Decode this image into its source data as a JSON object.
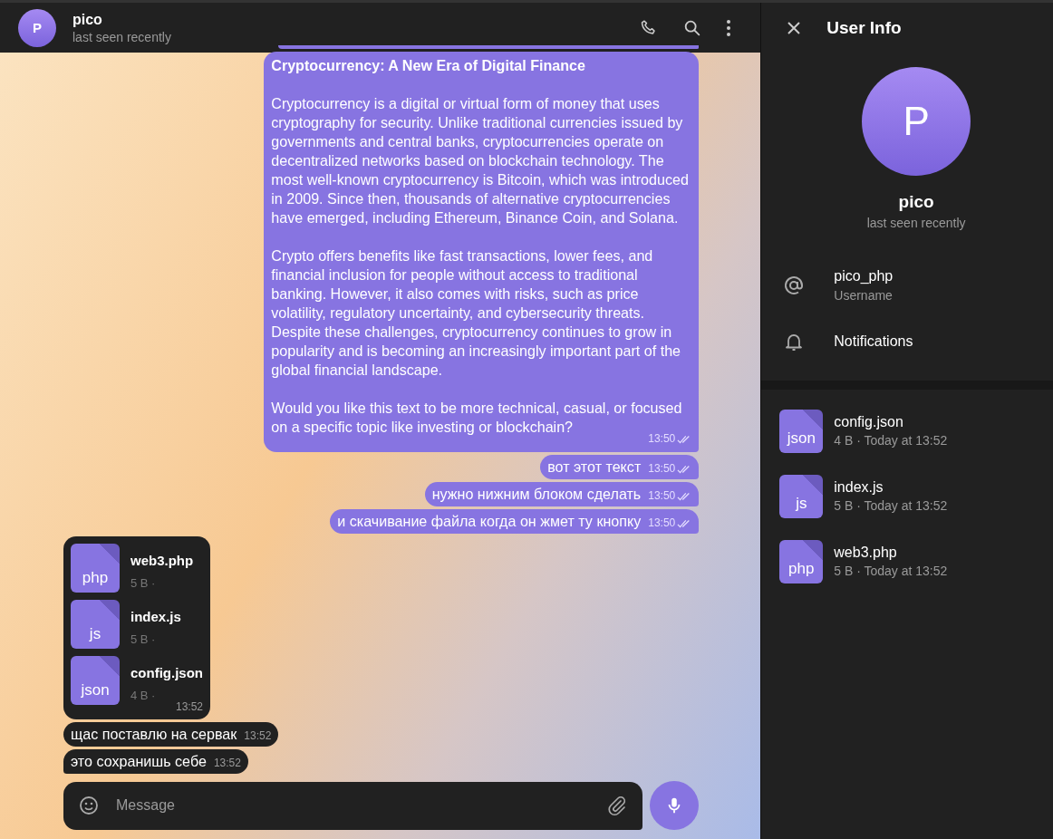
{
  "chat_header": {
    "avatar_letter": "P",
    "name": "pico",
    "status": "last seen recently"
  },
  "messages": [
    {
      "kind": "stub",
      "outgoing": true
    },
    {
      "kind": "text",
      "outgoing": true,
      "title": "Cryptocurrency: A New Era of Digital Finance",
      "paragraphs": [
        "Cryptocurrency is a digital or virtual form of money that uses cryptography for security. Unlike traditional currencies issued by governments and central banks, cryptocurrencies operate on decentralized networks based on blockchain technology. The most well-known cryptocurrency is Bitcoin, which was introduced in 2009. Since then, thousands of alternative cryptocurrencies have emerged, including Ethereum, Binance Coin, and Solana.",
        "Crypto offers benefits like fast transactions, lower fees, and financial inclusion for people without access to traditional banking. However, it also comes with risks, such as price volatility, regulatory uncertainty, and cybersecurity threats. Despite these challenges, cryptocurrency continues to grow in popularity and is becoming an increasingly important part of the global financial landscape.",
        "Would you like this text to be more technical, casual, or focused on a specific topic like investing or blockchain?"
      ],
      "time": "13:50",
      "read": true
    },
    {
      "kind": "text",
      "outgoing": true,
      "paragraphs": [
        "вот этот текст"
      ],
      "time": "13:50",
      "read": true
    },
    {
      "kind": "text",
      "outgoing": true,
      "paragraphs": [
        "нужно нижним блоком сделать"
      ],
      "time": "13:50",
      "read": true
    },
    {
      "kind": "text",
      "outgoing": true,
      "paragraphs": [
        "и скачивание файла когда он жмет ту кнопку"
      ],
      "time": "13:50",
      "read": true
    },
    {
      "kind": "files",
      "outgoing": false,
      "files": [
        {
          "ext": "php",
          "name": "web3.php",
          "size": "5 B ·"
        },
        {
          "ext": "js",
          "name": "index.js",
          "size": "5 B ·"
        },
        {
          "ext": "json",
          "name": "config.json",
          "size": "4 B ·"
        }
      ],
      "time": "13:52"
    },
    {
      "kind": "text",
      "outgoing": false,
      "paragraphs": [
        "щас поставлю на сервак"
      ],
      "time": "13:52"
    },
    {
      "kind": "text",
      "outgoing": false,
      "paragraphs": [
        "это сохранишь себе"
      ],
      "time": "13:52",
      "tail": true
    }
  ],
  "composer": {
    "placeholder": "Message"
  },
  "user_info": {
    "title": "User Info",
    "avatar_letter": "P",
    "name": "pico",
    "status": "last seen recently",
    "username": "pico_php",
    "username_label": "Username",
    "notifications_label": "Notifications",
    "files": [
      {
        "ext": "json",
        "name": "config.json",
        "meta": "4 B · Today at 13:52"
      },
      {
        "ext": "js",
        "name": "index.js",
        "meta": "5 B · Today at 13:52"
      },
      {
        "ext": "php",
        "name": "web3.php",
        "meta": "5 B · Today at 13:52"
      }
    ]
  }
}
